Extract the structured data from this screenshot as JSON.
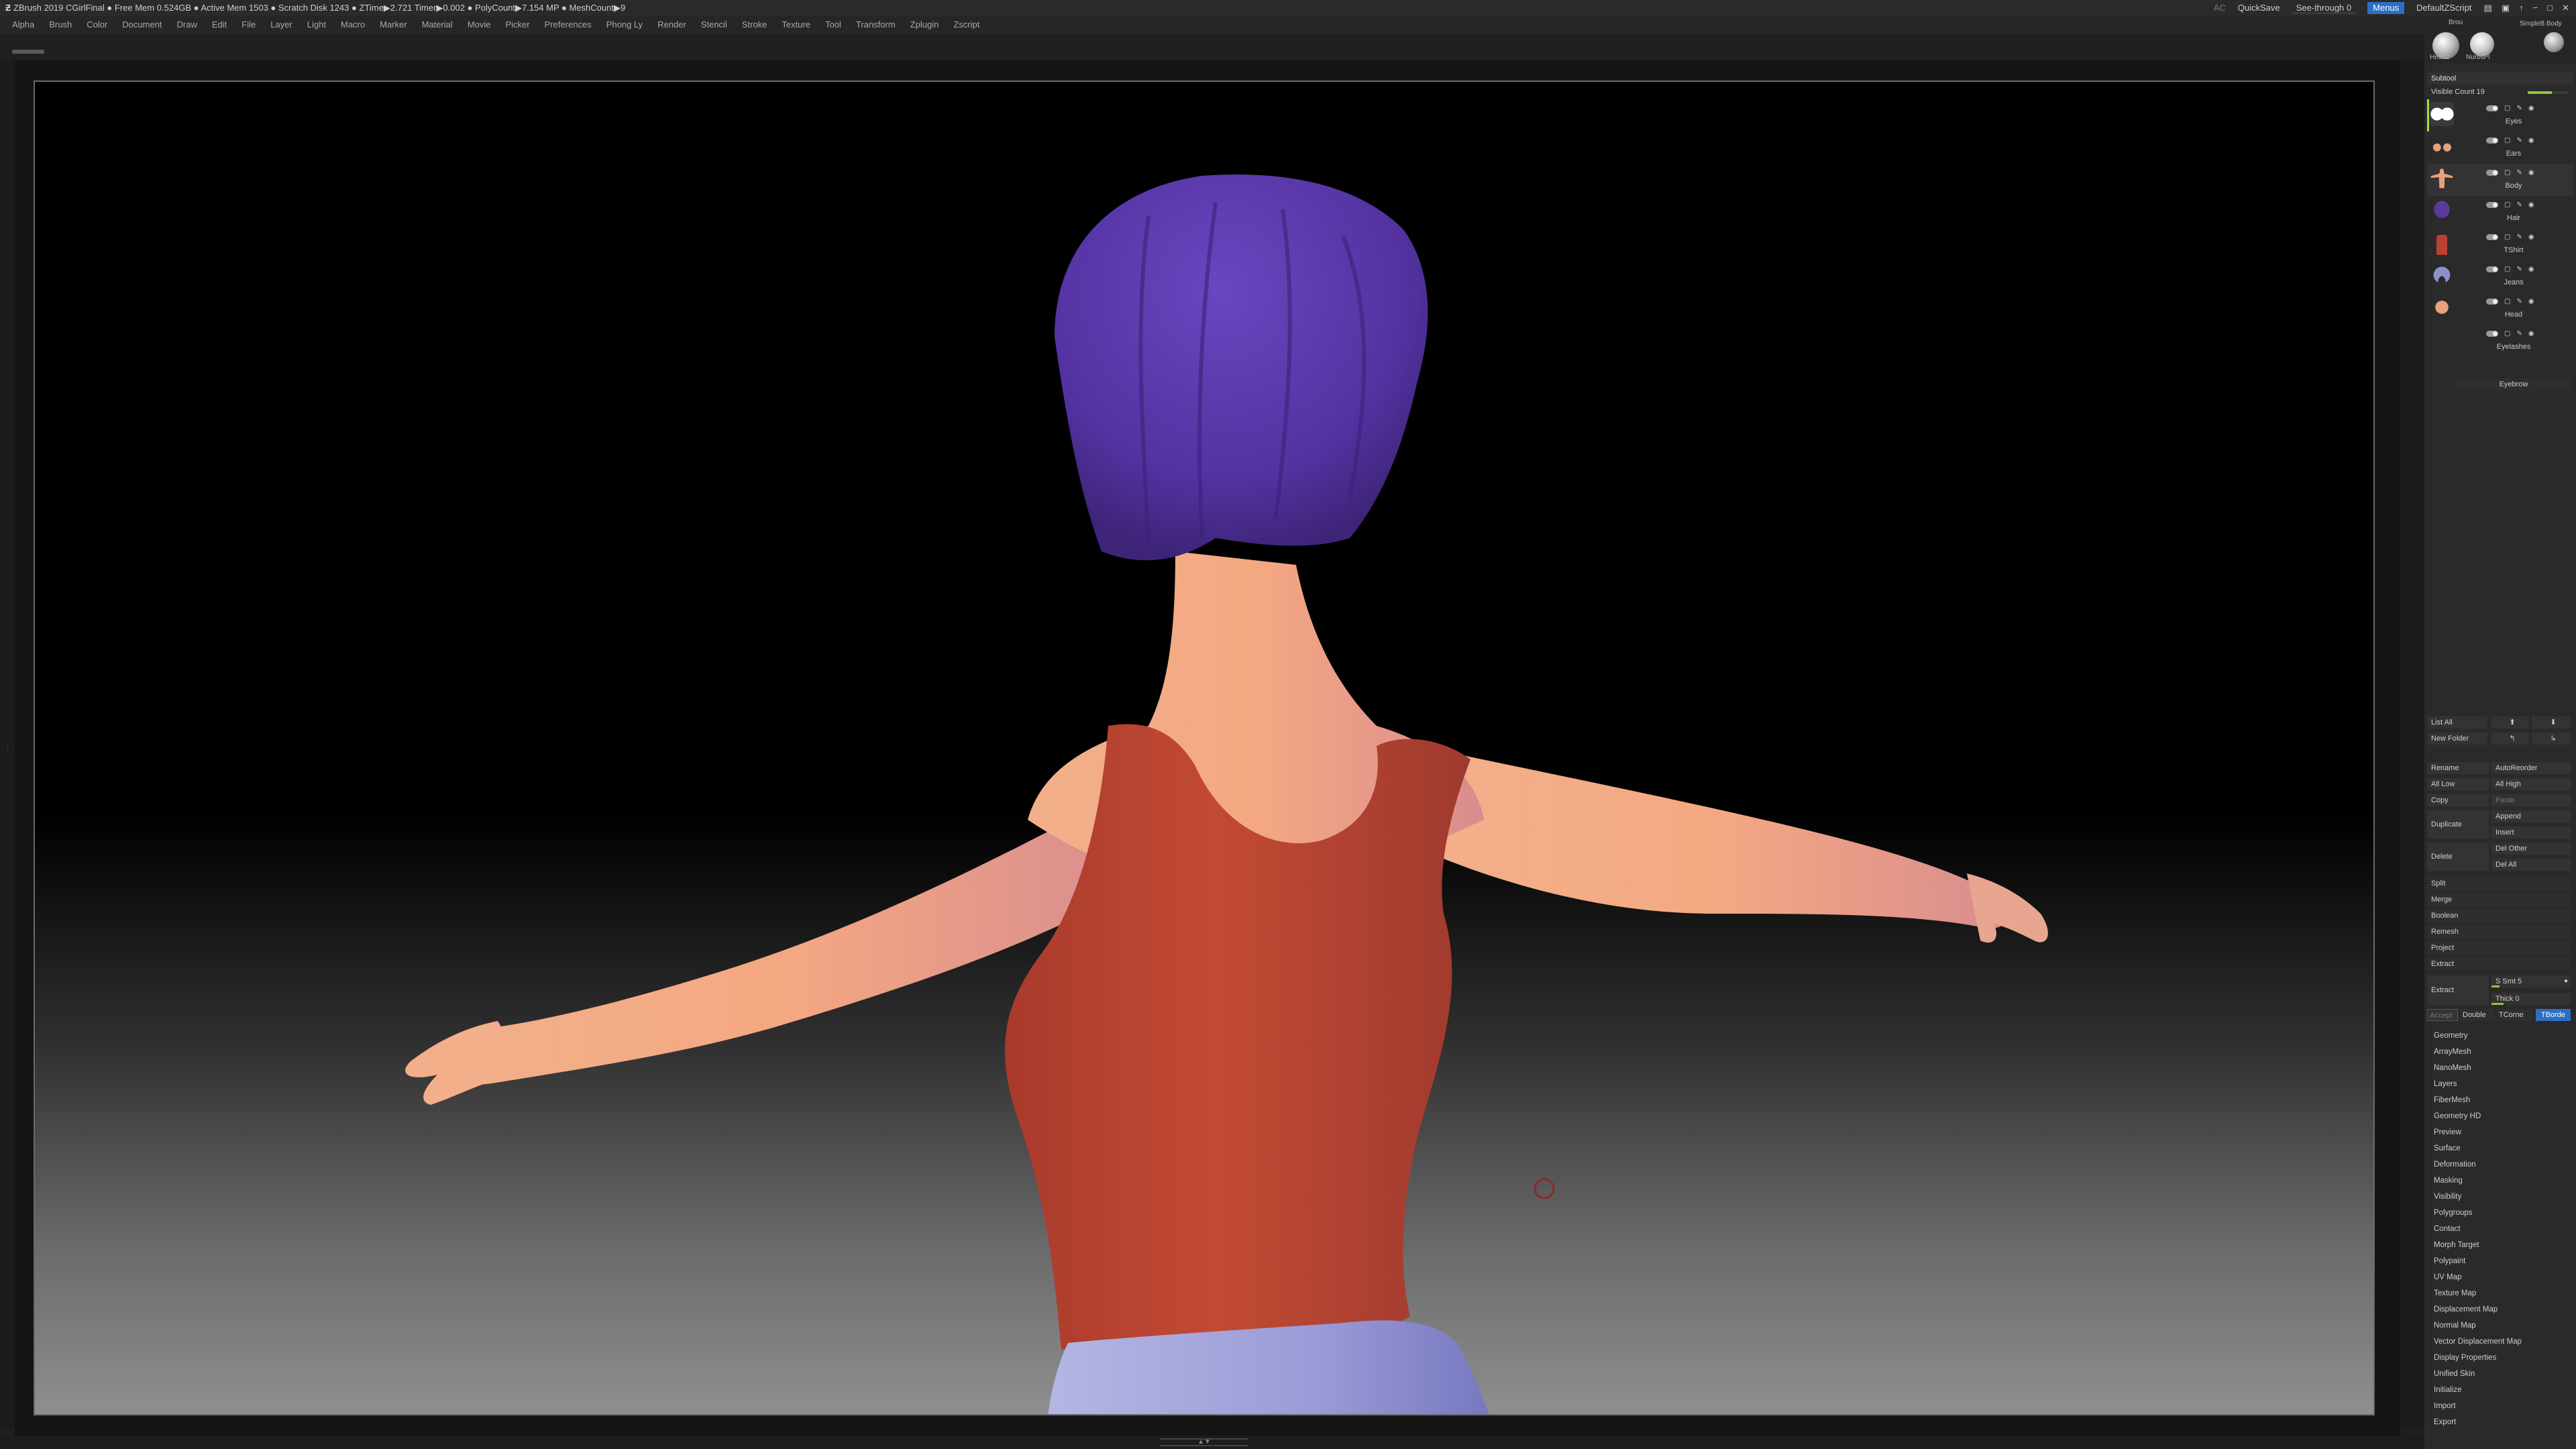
{
  "titlebar": {
    "app_title": "ZBrush 2019   CGirlFinal  ● Free Mem 0.524GB ● Active Mem 1503 ● Scratch Disk 1243 ● ZTime▶2.721 Timer▶0.002 ● PolyCount▶7.154 MP  ● MeshCount▶9",
    "ac_label": "AC",
    "quicksave_label": "QuickSave",
    "seethrough_label": "See-through  0",
    "seethrough_value": 0,
    "menus_label": "Menus",
    "script_label": "DefaultZScript",
    "window_icons": [
      "▤",
      "▣",
      "↑",
      "−",
      "□",
      "✕"
    ]
  },
  "menubar": {
    "items": [
      "Alpha",
      "Brush",
      "Color",
      "Document",
      "Draw",
      "Edit",
      "File",
      "Layer",
      "Light",
      "Macro",
      "Marker",
      "Material",
      "Movie",
      "Picker",
      "Preferences",
      "Phong Ly",
      "Render",
      "Stencil",
      "Stroke",
      "Texture",
      "Tool",
      "Transform",
      "Zplugin",
      "Zscript"
    ]
  },
  "right_panel": {
    "brushes": {
      "b1_top_label": "Brou",
      "b1_label": "Head2",
      "b2_label": "NurbsPl",
      "b3_top_label": "SimpleB",
      "b3_label": "Body"
    },
    "subtool_header": "Subtool",
    "visible_count_label": "Visible Count 19",
    "visible_count_fraction": 0.6,
    "subtools": [
      {
        "name": "Eyes",
        "thumb": "#cfcfcf"
      },
      {
        "name": "Ears",
        "thumb": "#e2a27e"
      },
      {
        "name": "Body",
        "thumb": "#e9a07a"
      },
      {
        "name": "Hair",
        "thumb": "#5b3a9c"
      },
      {
        "name": "TShirt",
        "thumb": "#b84133"
      },
      {
        "name": "Jeans",
        "thumb": "#8a92c6"
      },
      {
        "name": "Head",
        "thumb": "#e7a27c"
      },
      {
        "name": "Eyelashes",
        "thumb": "#2a2a2a"
      }
    ],
    "eyebrow_label": "Eyebrow",
    "buttons": {
      "list_all": "List All",
      "new_folder": "New Folder",
      "rename": "Rename",
      "auto_reorder": "AutoReorder",
      "all_low": "All Low",
      "all_high": "All High",
      "copy": "Copy",
      "paste": "Paste",
      "duplicate": "Duplicate",
      "append": "Append",
      "insert": "Insert",
      "delete": "Delete",
      "del_other": "Del Other",
      "del_all": "Del All",
      "split": "Split",
      "merge": "Merge",
      "boolean": "Boolean",
      "remesh": "Remesh",
      "project": "Project",
      "extract_top": "Extract",
      "extract": "Extract",
      "s_smt": "S Smt 5",
      "thick": "Thick 0",
      "accept": "Accept",
      "double": "Double",
      "tcorne": "TCorne",
      "tborde": "TBorde"
    },
    "menu_list": [
      "Geometry",
      "ArrayMesh",
      "NanoMesh",
      "Layers",
      "FiberMesh",
      "Geometry HD",
      "Preview",
      "Surface",
      "Deformation",
      "Masking",
      "Visibility",
      "Polygroups",
      "Contact",
      "Morph Target",
      "Polypaint",
      "UV Map",
      "Texture Map",
      "Displacement Map",
      "Normal Map",
      "Vector Displacement Map",
      "Display Properties",
      "Unified Skin",
      "Initialize",
      "Import",
      "Export"
    ]
  },
  "colors": {
    "hair": "#5a35a8",
    "skin": "#f0a57c",
    "shirt": "#b8432f",
    "jeans": "#8e8fd0",
    "accent_blue": "#2c6fc4",
    "accent_green": "#8fc93a"
  }
}
